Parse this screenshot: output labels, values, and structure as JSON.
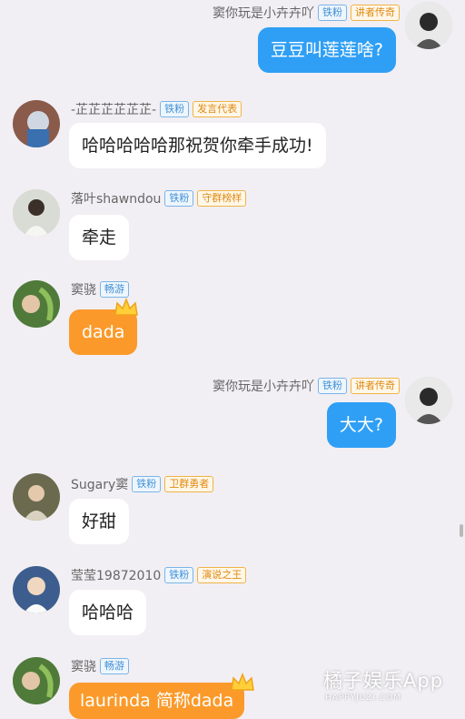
{
  "messages": [
    {
      "name": "窦你玩是小卉卉吖",
      "badges": [
        "铁粉",
        "讲者传奇"
      ],
      "text": "豆豆叫莲莲啥?",
      "style": "blue",
      "side": "right"
    },
    {
      "name": "-芷芷芷芷芷芷-",
      "badges": [
        "铁粉",
        "发言代表"
      ],
      "text": "哈哈哈哈哈那祝贺你牵手成功!",
      "style": "white",
      "side": "left"
    },
    {
      "name": "落叶shawndou",
      "badges": [
        "铁粉",
        "守群榜样"
      ],
      "text": "牵走",
      "style": "white",
      "side": "left"
    },
    {
      "name": "窦骁",
      "badges": [
        "畅游"
      ],
      "text": "dada",
      "style": "orange",
      "side": "left"
    },
    {
      "name": "窦你玩是小卉卉吖",
      "badges": [
        "铁粉",
        "讲者传奇"
      ],
      "text": "大大?",
      "style": "blue",
      "side": "right"
    },
    {
      "name": "Sugary窦",
      "badges": [
        "铁粉",
        "卫群勇者"
      ],
      "text": "好甜",
      "style": "white",
      "side": "left"
    },
    {
      "name": "莹莹19872010",
      "badges": [
        "铁粉",
        "演说之王"
      ],
      "text": "哈哈哈",
      "style": "white",
      "side": "left"
    },
    {
      "name": "窦骁",
      "badges": [
        "畅游"
      ],
      "text": "laurinda 简称dada",
      "style": "orange",
      "side": "left"
    }
  ],
  "watermark": {
    "main": "橘子娱乐App",
    "sub": "HAPPYJUZI.COM"
  },
  "colors": {
    "blue_bubble": "#2f9ff5",
    "orange_bubble": "#fb9a2a",
    "background": "#f1eff3"
  }
}
